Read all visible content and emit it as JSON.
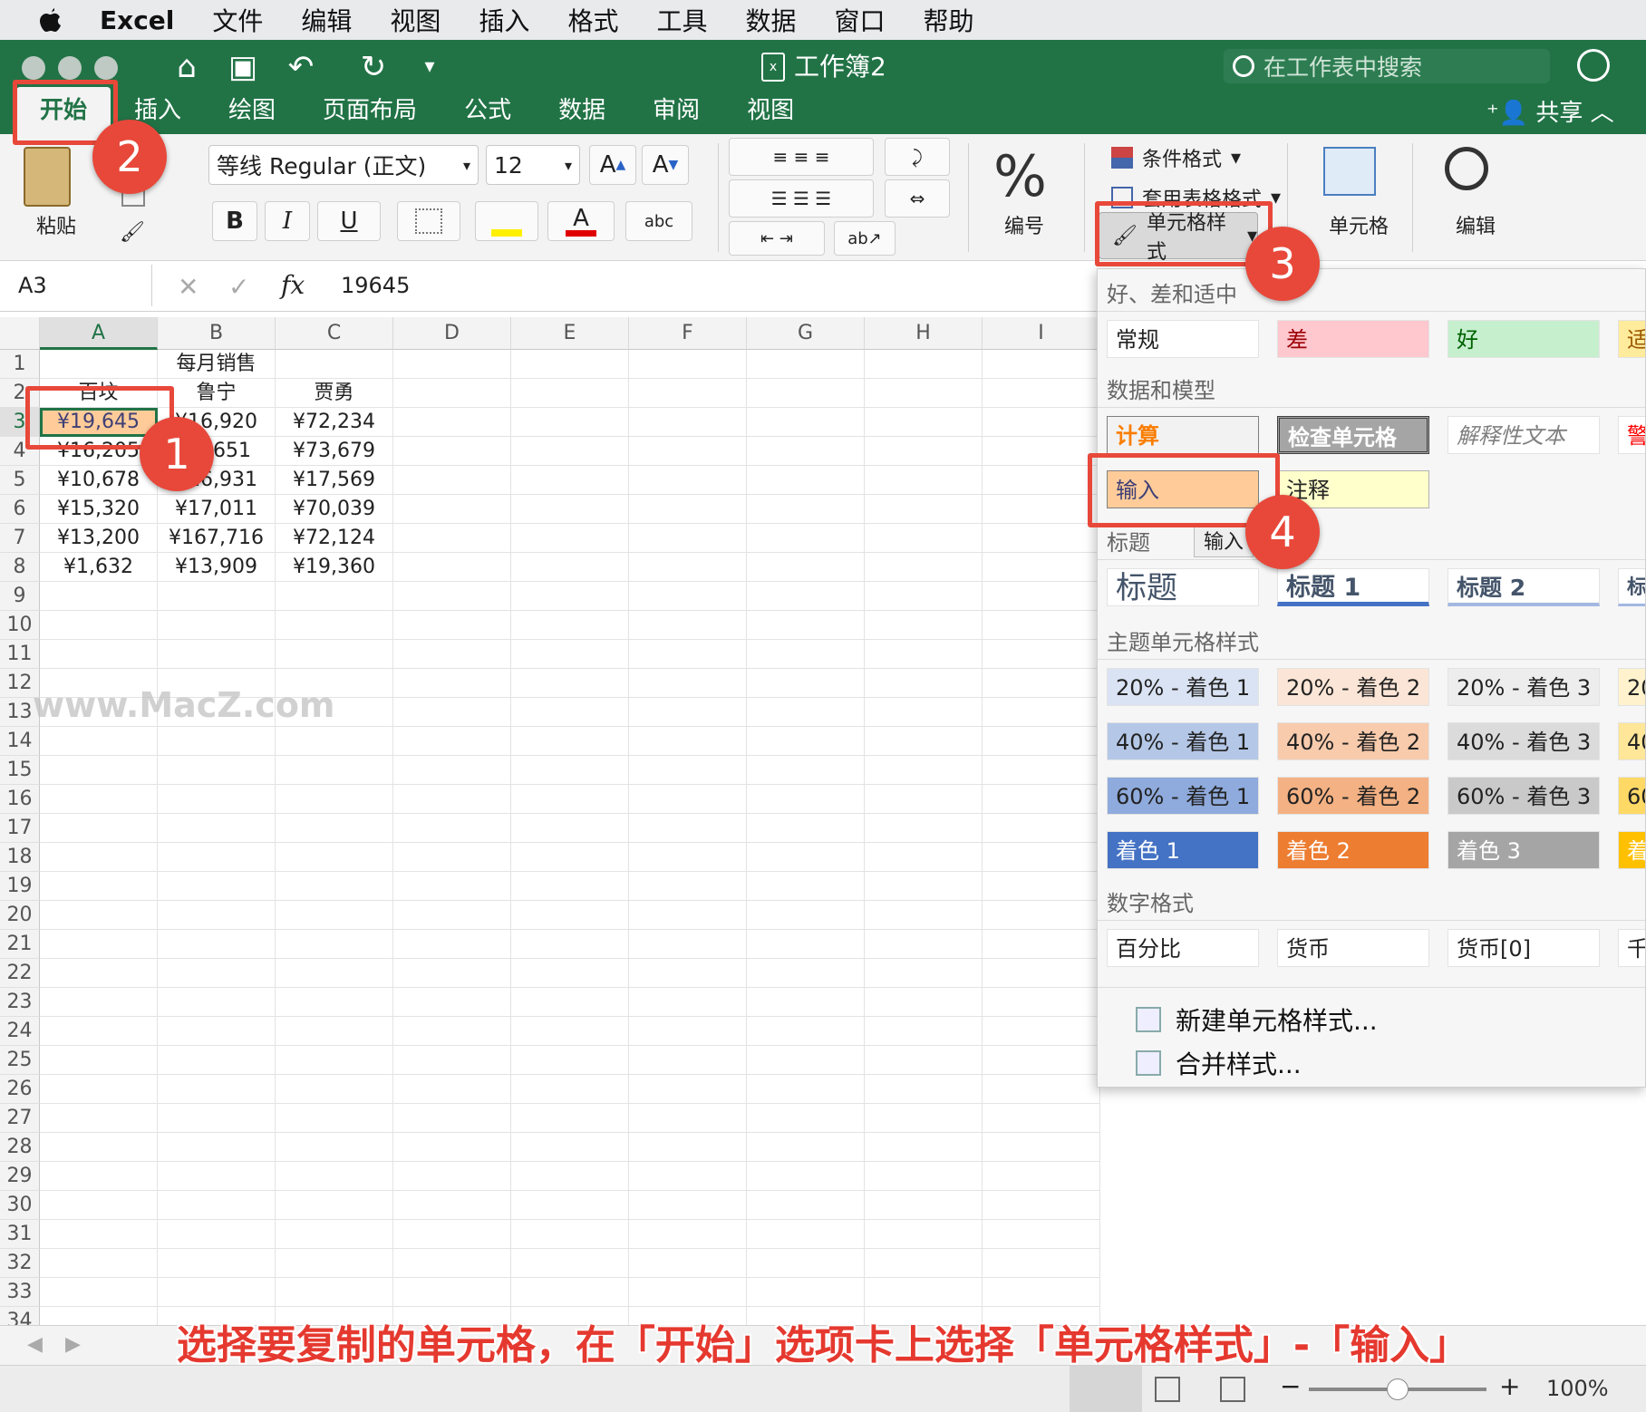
{
  "menubar": {
    "app": "Excel",
    "items": [
      "文件",
      "编辑",
      "视图",
      "插入",
      "格式",
      "工具",
      "数据",
      "窗口",
      "帮助"
    ]
  },
  "window": {
    "title": "工作簿2",
    "search_placeholder": "在工作表中搜索",
    "share": "共享"
  },
  "tabs": [
    "开始",
    "插入",
    "绘图",
    "页面布局",
    "公式",
    "数据",
    "审阅",
    "视图"
  ],
  "ribbon": {
    "paste": "粘贴",
    "font_name": "等线 Regular (正文)",
    "font_size": "12",
    "bold": "B",
    "italic": "I",
    "underline": "U",
    "number_label": "编号",
    "conditional_format": "条件格式",
    "table_format": "套用表格格式",
    "cell_styles": "单元格样式",
    "cells": "单元格",
    "editing": "编辑",
    "font_grow": "A",
    "font_shrink": "A",
    "abc": "abc",
    "font_color_letter": "A",
    "percent": "%"
  },
  "formula_bar": {
    "name_box": "A3",
    "fx": "fx",
    "value": "19645"
  },
  "columns": [
    "A",
    "B",
    "C",
    "D",
    "E",
    "F",
    "G",
    "H",
    "I"
  ],
  "rows": [
    "1",
    "2",
    "3",
    "4",
    "5",
    "6",
    "7",
    "8",
    "9",
    "10",
    "11",
    "12",
    "13",
    "14",
    "15",
    "16",
    "17",
    "18",
    "19",
    "20",
    "21",
    "22",
    "23",
    "24",
    "25",
    "26",
    "27",
    "28",
    "29",
    "30",
    "31",
    "32",
    "33",
    "34"
  ],
  "sheet": {
    "r1": [
      "",
      "每月销售",
      ""
    ],
    "r2": [
      "百坟",
      "鲁宁",
      "贾勇"
    ],
    "r3": [
      "¥19,645",
      "¥16,920",
      "¥72,234"
    ],
    "r4": [
      "¥16,205",
      "¥7,651",
      "¥73,679"
    ],
    "r5": [
      "¥10,678",
      "¥16,931",
      "¥17,569"
    ],
    "r6": [
      "¥15,320",
      "¥17,011",
      "¥70,039"
    ],
    "r7": [
      "¥13,200",
      "¥167,716",
      "¥72,124"
    ],
    "r8": [
      "¥1,632",
      "¥13,909",
      "¥19,360"
    ]
  },
  "panel": {
    "sec_good_bad": "好、差和适中",
    "good_bad": [
      "常规",
      "差",
      "好",
      "适"
    ],
    "sec_data_model": "数据和模型",
    "data_model": [
      "计算",
      "检查单元格",
      "解释性文本",
      "警"
    ],
    "data_model2": [
      "输入",
      "注释"
    ],
    "tooltip": "输入",
    "sec_titles": "标题",
    "titles": [
      "标题",
      "标题 1",
      "标题 2",
      "标"
    ],
    "sec_theme": "主题单元格样式",
    "theme20": [
      "20% - 着色 1",
      "20% - 着色 2",
      "20% - 着色 3",
      "20"
    ],
    "theme40": [
      "40% - 着色 1",
      "40% - 着色 2",
      "40% - 着色 3",
      "40"
    ],
    "theme60": [
      "60% - 着色 1",
      "60% - 着色 2",
      "60% - 着色 3",
      "60"
    ],
    "accent": [
      "着色 1",
      "着色 2",
      "着色 3",
      "着"
    ],
    "sec_number": "数字格式",
    "number": [
      "百分比",
      "货币",
      "货币[0]",
      "千"
    ],
    "new_style": "新建单元格样式...",
    "merge_style": "合并样式..."
  },
  "annotations": {
    "b1": "1",
    "b2": "2",
    "b3": "3",
    "b4": "4"
  },
  "caption": "选择要复制的单元格，在「开始」选项卡上选择「单元格样式」-「输入」",
  "watermark": "www.MacZ.com",
  "status": {
    "zoom": "100%"
  }
}
